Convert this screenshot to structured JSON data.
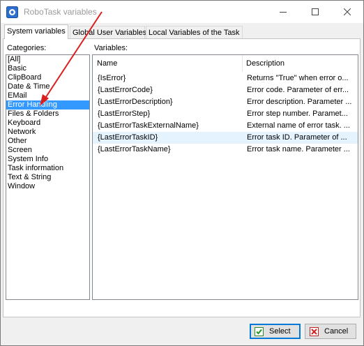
{
  "window": {
    "title": "RoboTask variables",
    "icons": {
      "app": "robotask-app-icon",
      "minimize": "minimize-icon",
      "maximize": "maximize-icon",
      "close": "close-icon"
    }
  },
  "tabs": [
    {
      "label": "System variables",
      "active": true
    },
    {
      "label": "Global User Variables",
      "active": false
    },
    {
      "label": "Local Variables of the Task",
      "active": false
    }
  ],
  "categories": {
    "label": "Categories:",
    "items": [
      {
        "label": "[All]",
        "selected": false
      },
      {
        "label": "Basic",
        "selected": false
      },
      {
        "label": "ClipBoard",
        "selected": false
      },
      {
        "label": "Date & Time",
        "selected": false
      },
      {
        "label": "EMail",
        "selected": false
      },
      {
        "label": "Error Handling",
        "selected": true
      },
      {
        "label": "Files & Folders",
        "selected": false
      },
      {
        "label": "Keyboard",
        "selected": false
      },
      {
        "label": "Network",
        "selected": false
      },
      {
        "label": "Other",
        "selected": false
      },
      {
        "label": "Screen",
        "selected": false
      },
      {
        "label": "System Info",
        "selected": false
      },
      {
        "label": "Task information",
        "selected": false
      },
      {
        "label": "Text & String",
        "selected": false
      },
      {
        "label": "Window",
        "selected": false
      }
    ]
  },
  "variables": {
    "label": "Variables:",
    "columns": {
      "name": "Name",
      "description": "Description"
    },
    "rows": [
      {
        "name": "{IsError}",
        "description": "Returns \"True\" when error o...",
        "highlight": false
      },
      {
        "name": "{LastErrorCode}",
        "description": "Error code. Parameter of err...",
        "highlight": false
      },
      {
        "name": "{LastErrorDescription}",
        "description": "Error description. Parameter ...",
        "highlight": false
      },
      {
        "name": "{LastErrorStep}",
        "description": "Error step number. Paramet...",
        "highlight": false
      },
      {
        "name": "{LastErrorTaskExternalName}",
        "description": "External name of error task. ...",
        "highlight": false
      },
      {
        "name": "{LastErrorTaskID}",
        "description": "Error task ID. Parameter of ...",
        "highlight": true
      },
      {
        "name": "{LastErrorTaskName}",
        "description": "Error task name. Parameter ...",
        "highlight": false
      }
    ]
  },
  "buttons": {
    "select": {
      "label": "Select",
      "icon": "checkmark-icon"
    },
    "cancel": {
      "label": "Cancel",
      "icon": "cancel-x-icon"
    }
  },
  "colors": {
    "selection": "#3399ff",
    "row_highlight": "#e5f3ff",
    "annotation_arrow": "#d92020",
    "default_button_border": "#0078d7"
  },
  "annotation": {
    "type": "arrow",
    "points_to": "Error Handling"
  }
}
